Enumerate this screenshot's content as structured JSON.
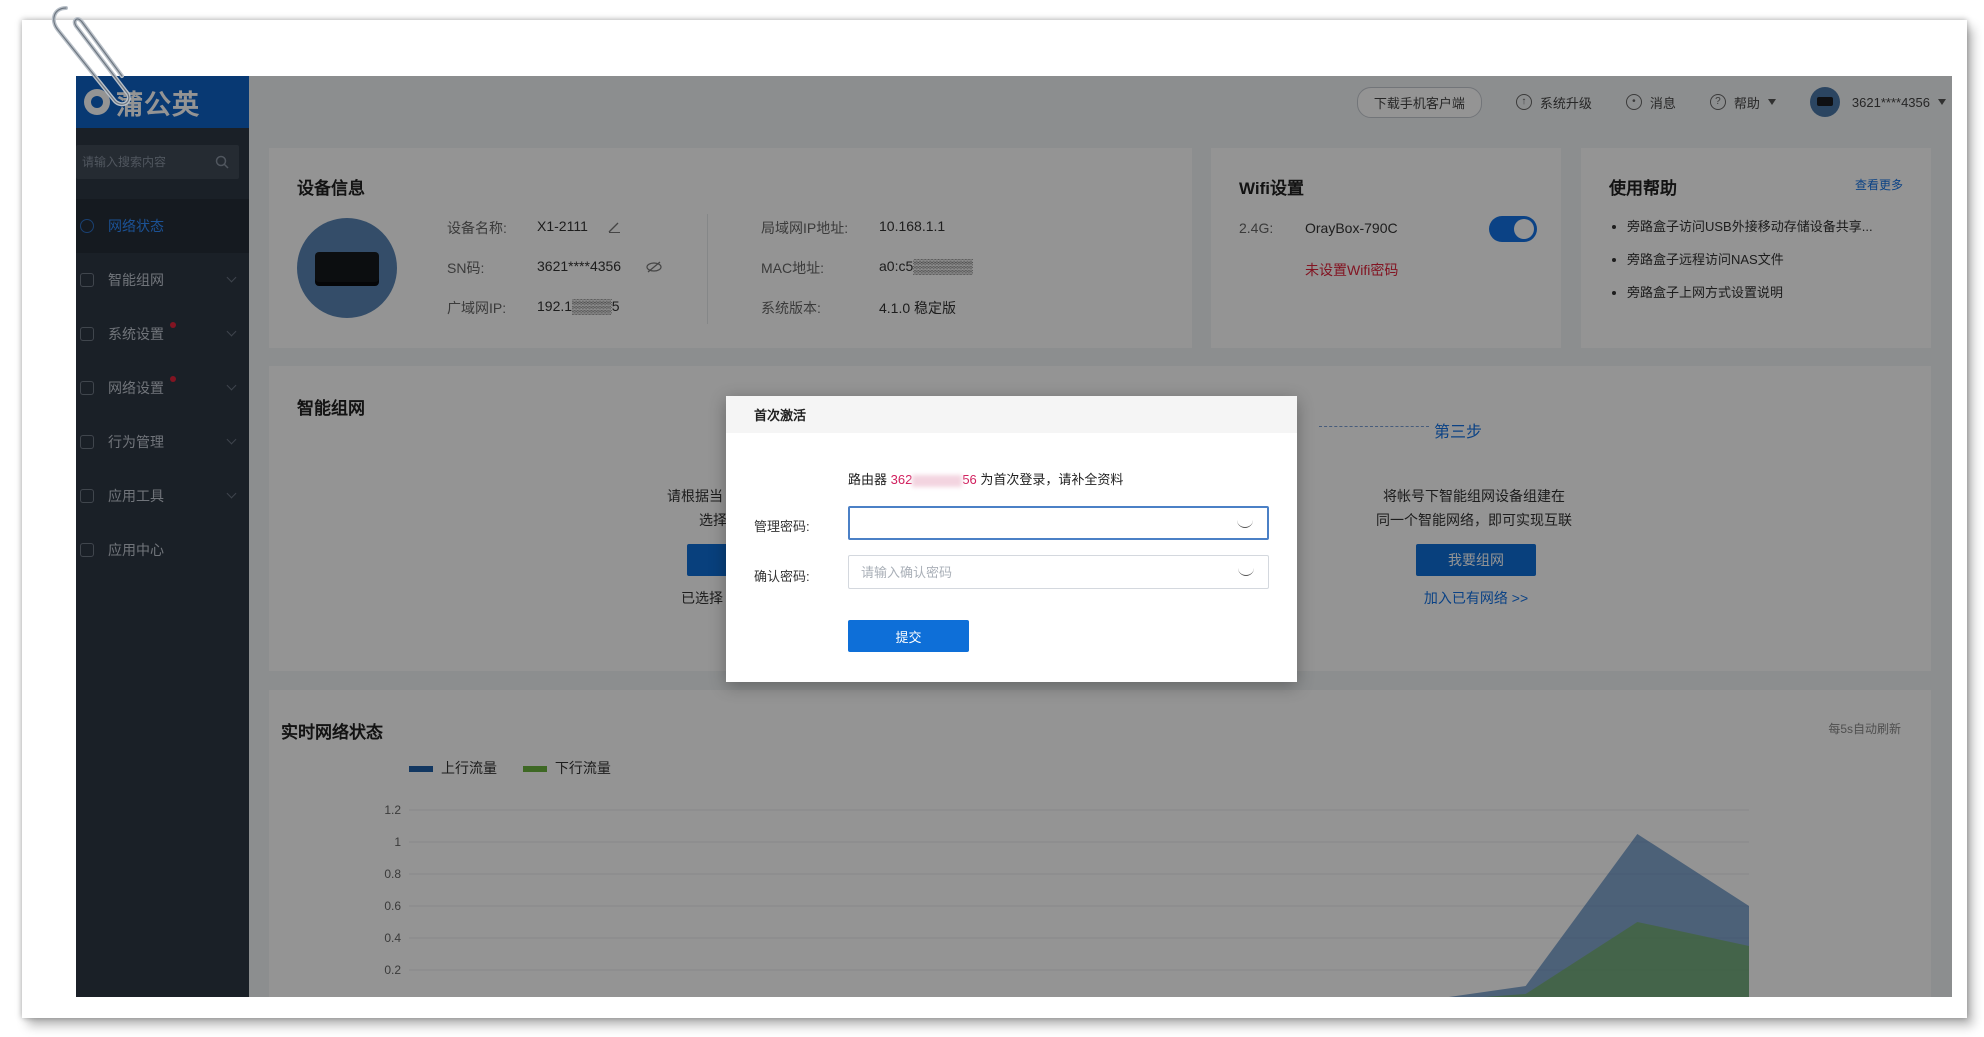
{
  "app": {
    "brand": "蒲公英",
    "search_placeholder": "请输入搜索内容"
  },
  "sidebar": {
    "items": [
      {
        "label": "网络状态",
        "active": true
      },
      {
        "label": "智能组网"
      },
      {
        "label": "系统设置",
        "dot": true
      },
      {
        "label": "网络设置",
        "dot": true
      },
      {
        "label": "行为管理"
      },
      {
        "label": "应用工具"
      },
      {
        "label": "应用中心"
      }
    ]
  },
  "topbar": {
    "download": "下载手机客户端",
    "upgrade": "系统升级",
    "messages": "消息",
    "help": "帮助",
    "account": "3621****4356"
  },
  "device_info": {
    "title": "设备信息",
    "name_label": "设备名称:",
    "name_value": "X1-2111",
    "sn_label": "SN码:",
    "sn_value": "3621****4356",
    "wan_label": "广域网IP:",
    "wan_value": "192.1▒▒▒▒5",
    "lan_label": "局域网IP地址:",
    "lan_value": "10.168.1.1",
    "mac_label": "MAC地址:",
    "mac_value": "a0:c5▒▒▒▒▒▒",
    "version_label": "系统版本:",
    "version_value": "4.1.0 稳定版"
  },
  "wifi": {
    "title": "Wifi设置",
    "band": "2.4G:",
    "ssid": "OrayBox-790C",
    "enabled": true,
    "warning": "未设置Wifi密码"
  },
  "help_card": {
    "title": "使用帮助",
    "more": "查看更多",
    "items": [
      "旁路盒子访问USB外接移动存储设备共享...",
      "旁路盒子远程访问NAS文件",
      "旁路盒子上网方式设置说明"
    ]
  },
  "smart_net": {
    "title": "智能组网",
    "step3": "第三步",
    "left_text1": "请根据当",
    "left_text2": "选择",
    "left_selected": "已选择",
    "right_text1": "将帐号下智能组网设备组建在",
    "right_text2": "同一个智能网络，即可实现互联",
    "build_btn": "我要组网",
    "join_link": "加入已有网络 >>"
  },
  "realtime": {
    "title": "实时网络状态",
    "refresh": "每5s自动刷新",
    "legend_up": "上行流量",
    "legend_down": "下行流量",
    "color_up": "#1f5fa8",
    "color_down": "#6cb33f"
  },
  "chart_data": {
    "type": "area",
    "title": "实时网络状态",
    "series": [
      {
        "name": "上行流量",
        "values": [
          0,
          0,
          0,
          0,
          0,
          0,
          0,
          0,
          0,
          0,
          0.1,
          1.05,
          0.6
        ]
      },
      {
        "name": "下行流量",
        "values": [
          0,
          0,
          0,
          0,
          0,
          0,
          0,
          0,
          0,
          0,
          0.05,
          0.5,
          0.35
        ]
      }
    ],
    "yticks": [
      "1.2",
      "1",
      "0.8",
      "0.6",
      "0.4",
      "0.2"
    ],
    "ylim": [
      0,
      1.2
    ],
    "grid": true,
    "legend": "top-left"
  },
  "modal": {
    "title": "首次激活",
    "info_prefix": "路由器 ",
    "sn_start": "362",
    "sn_end": "56",
    "info_suffix": " 为首次登录，请补全资料",
    "pwd_label": "管理密码:",
    "pwd_value": "",
    "confirm_label": "确认密码:",
    "confirm_placeholder": "请输入确认密码",
    "submit": "提交"
  }
}
